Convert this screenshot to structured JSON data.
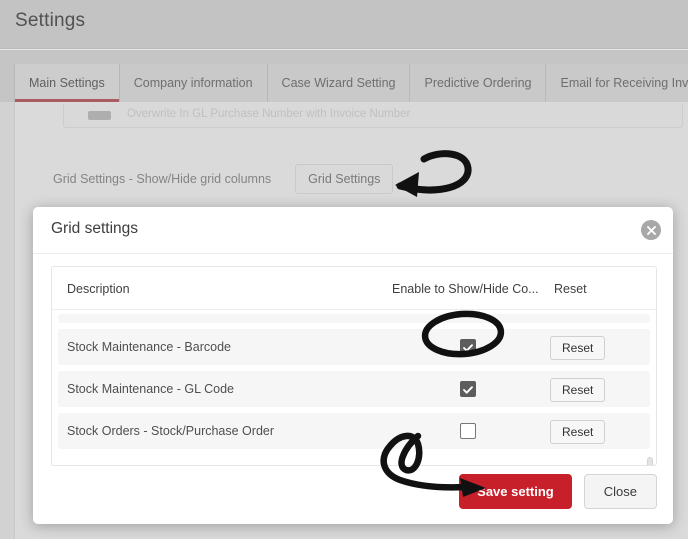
{
  "header": {
    "title": "Settings"
  },
  "tabs": [
    {
      "label": "Main Settings",
      "active": true
    },
    {
      "label": "Company information",
      "active": false
    },
    {
      "label": "Case Wizard Setting",
      "active": false
    },
    {
      "label": "Predictive Ordering",
      "active": false
    },
    {
      "label": "Email for Receiving Invoice",
      "active": false
    }
  ],
  "page_body": {
    "faint_row_text": "Overwrite In GL Purchase Number with Invoice Number",
    "grid_settings_label": "Grid Settings - Show/Hide grid columns",
    "grid_settings_button": "Grid Settings"
  },
  "modal": {
    "title": "Grid settings",
    "close_icon": "close-circle-icon",
    "table": {
      "columns": [
        "Description",
        "Enable to Show/Hide Co...",
        "Reset"
      ],
      "rows": [
        {
          "description": "Stock Maintenance - Barcode",
          "checked": true,
          "reset_label": "Reset"
        },
        {
          "description": "Stock Maintenance - GL Code",
          "checked": true,
          "reset_label": "Reset"
        },
        {
          "description": "Stock Orders - Stock/Purchase Order",
          "checked": false,
          "reset_label": "Reset"
        }
      ]
    },
    "footer": {
      "save_label": "Save setting",
      "close_label": "Close"
    }
  },
  "colors": {
    "accent_red": "#c8202a",
    "tab_underline": "#b5575c",
    "checkbox_on": "#5d5d5d",
    "page_header_bg": "#d2d2d2",
    "annotation_ink": "#111111"
  },
  "annotations": [
    {
      "name": "arrow-to-grid-settings",
      "shape": "curved-arrow-left"
    },
    {
      "name": "circle-around-barcode-checkbox",
      "shape": "ellipse"
    },
    {
      "name": "arrow-to-save-setting",
      "shape": "curved-arrow-right"
    }
  ]
}
